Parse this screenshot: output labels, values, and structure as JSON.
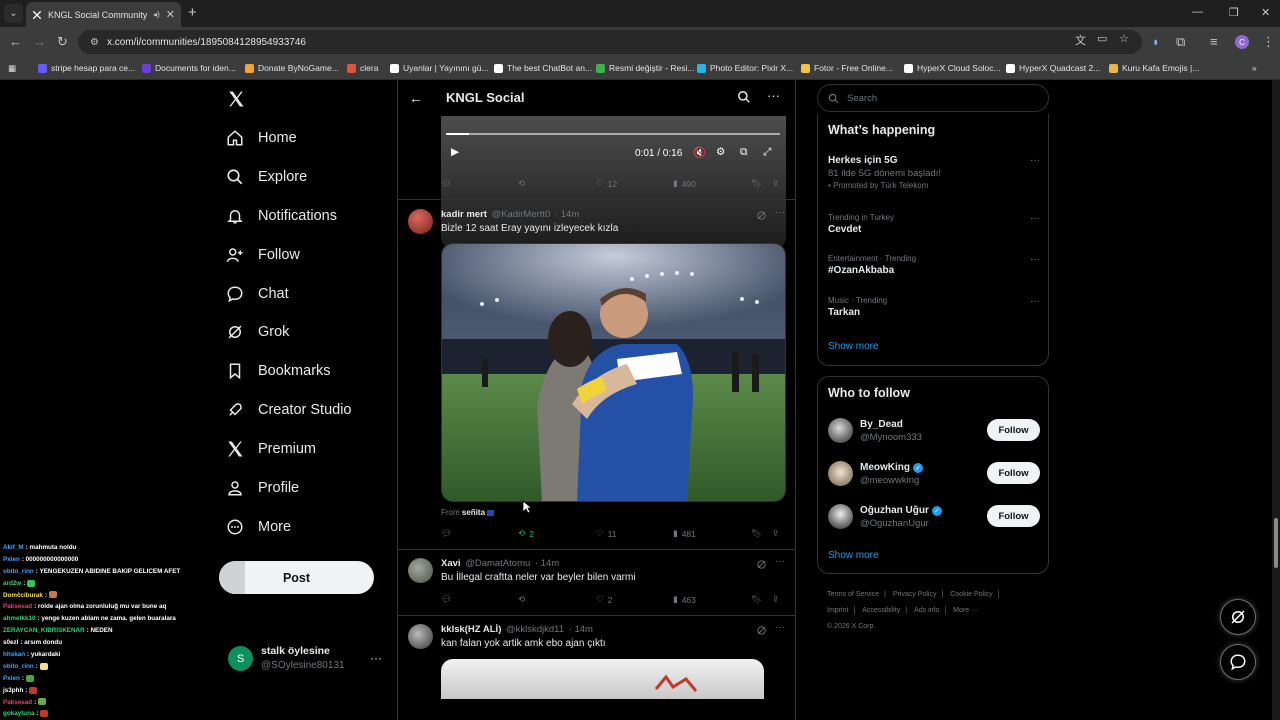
{
  "browser": {
    "tab_title": "KNGL Social Community / X",
    "url": "x.com/i/communities/1895084128954933746",
    "avatar_initial": "C",
    "bookmarks": [
      {
        "label": "stripe hesap para ce...",
        "color": "#635bff"
      },
      {
        "label": "Documents for iden...",
        "color": "#6b3fd6"
      },
      {
        "label": "Donate ByNoGame...",
        "color": "#f2a533"
      },
      {
        "label": "clera",
        "color": "#e0523b"
      },
      {
        "label": "Uyanlar | Yayınını gü...",
        "color": "#ffffff"
      },
      {
        "label": "The best ChatBot an...",
        "color": "#ffffff"
      },
      {
        "label": "Resmi değiştir - Resi...",
        "color": "#3db24b"
      },
      {
        "label": "Photo Editor: Pixlr X...",
        "color": "#2ab3e7"
      },
      {
        "label": "Fotor - Free Online...",
        "color": "#f4c542"
      },
      {
        "label": "HyperX Cloud Soloc...",
        "color": "#ffffff"
      },
      {
        "label": "HyperX Quadcast 2...",
        "color": "#ffffff"
      },
      {
        "label": "Kuru Kafa Emojis |...",
        "color": "#e6b84c"
      }
    ]
  },
  "nav": {
    "items": [
      {
        "label": "Home",
        "icon": "home-icon"
      },
      {
        "label": "Explore",
        "icon": "search-icon"
      },
      {
        "label": "Notifications",
        "icon": "bell-icon"
      },
      {
        "label": "Follow",
        "icon": "person-plus-icon"
      },
      {
        "label": "Chat",
        "icon": "chat-bubble-icon"
      },
      {
        "label": "Grok",
        "icon": "grok-icon"
      },
      {
        "label": "Bookmarks",
        "icon": "bookmark-icon"
      },
      {
        "label": "Creator Studio",
        "icon": "rocket-icon"
      },
      {
        "label": "Premium",
        "icon": "x-logo-icon"
      },
      {
        "label": "Profile",
        "icon": "person-icon"
      },
      {
        "label": "More",
        "icon": "more-circle-icon"
      }
    ],
    "post_label": "Post",
    "account": {
      "name": "stalk öylesine",
      "handle": "@SOylesine80131",
      "initial": "S"
    }
  },
  "chat_overlay": [
    {
      "user": "Akif_M",
      "color": "#3ea6ff",
      "msg": "mahmuta noldu"
    },
    {
      "user": "Pxien",
      "color": "#3ea6ff",
      "msg": "000000000000000"
    },
    {
      "user": "obito_rinn",
      "color": "#3ea6ff",
      "msg": "YENGEKUZEN ABIDINE BAKIP GELICEM AFET"
    },
    {
      "user": "ard2w",
      "color": "#2fd475",
      "msg": ""
    },
    {
      "user": "Domčciburak",
      "color": "#f4e04d",
      "msg": ""
    },
    {
      "user": "Paksesad",
      "color": "#e0476b",
      "msg": "rolde ajan olma zorunluluğ mu var bune aq"
    },
    {
      "user": "ahmetkk10",
      "color": "#2fd475",
      "msg": "yenge kuzen ablam ne zama. gelen buaralara"
    },
    {
      "user": "ZERAYCAN_KIBRISKENAR",
      "color": "#2fd475",
      "msg": "NEDEN"
    },
    {
      "user": "s0ezl",
      "color": "#ffffff",
      "msg": "arsım dondu"
    },
    {
      "user": "hhskan",
      "color": "#3ea6ff",
      "msg": "yukardaki"
    },
    {
      "user": "obito_rinn",
      "color": "#3ea6ff",
      "msg": ""
    },
    {
      "user": "Pxien",
      "color": "#3ea6ff",
      "msg": ""
    },
    {
      "user": "js3phh",
      "color": "#ffffff",
      "msg": ""
    },
    {
      "user": "Paksesad",
      "color": "#e0476b",
      "msg": ""
    },
    {
      "user": "gokaytuna",
      "color": "#2fd475",
      "msg": ""
    }
  ],
  "community": {
    "title": "KNGL Social",
    "video": {
      "time": "0:01 / 0:16",
      "progress": 0.07
    },
    "video_actions": {
      "likes": "12",
      "views": "490"
    },
    "posts": [
      {
        "name": "kadir mert",
        "handle": "@KadirMertt0",
        "time": "· 14m",
        "text": "Bizle 12 saat Eray yayını izleyecek kızla",
        "from_label": "From",
        "from_name": "señita",
        "retweets": "2",
        "likes": "11",
        "views": "481"
      },
      {
        "name": "Xavi",
        "handle": "@DamatAtomu",
        "time": "· 14m",
        "text": "Bu İllegal craftta neler var beyler bilen varmi",
        "likes": "2",
        "views": "463"
      },
      {
        "name": "kklsk(HZ ALİ)",
        "handle": "@kklskdjkd11",
        "time": "· 14m",
        "text": "kan falan yok artik amk ebo ajan çıktı"
      }
    ]
  },
  "sidebar": {
    "search_placeholder": "Search",
    "happening_title": "What’s happening",
    "trends": [
      {
        "context": "",
        "title": "Herkes için 5G",
        "sub": "81 ilde 5G dönemi başladı!",
        "promo": "Promoted by Türk Telekom"
      },
      {
        "context": "Trending in Turkey",
        "title": "Cevdet"
      },
      {
        "context": "Entertainment · Trending",
        "title": "#OzanAkbaba"
      },
      {
        "context": "Music · Trending",
        "title": "Tarkan"
      }
    ],
    "show_more": "Show more",
    "who_title": "Who to follow",
    "who": [
      {
        "name": "By_Dead",
        "handle": "@Mynoom333",
        "verified": false
      },
      {
        "name": "MeowKing",
        "handle": "@meowwking",
        "verified": true
      },
      {
        "name": "Oğuzhan Uğur",
        "handle": "@OguzhanUgur",
        "verified": true
      }
    ],
    "follow_label": "Follow",
    "footer": [
      "Terms of Service",
      "Privacy Policy",
      "Cookie Policy",
      "Imprint",
      "Accessibility",
      "Ads info",
      "More ···",
      "© 2026 X Corp."
    ]
  }
}
